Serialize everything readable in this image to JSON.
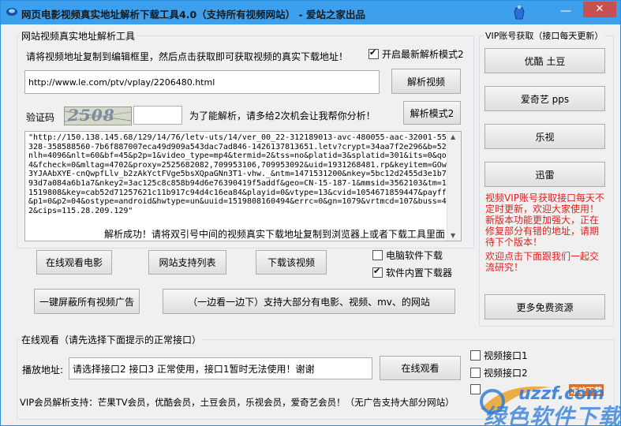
{
  "window": {
    "title": "网页电影视频真实地址解析下载工具4.0（支持所有视频网站） - 爱站之家出品",
    "minimize_glyph": "—",
    "close_glyph": "✕"
  },
  "parser": {
    "group_label": "网站视频真实地址解析工具",
    "instruction": "请将视频地址复制到编辑框里，然后点击获取即可获取视频的真实下载地址！",
    "latest_mode_label": "开启最新解析模式2",
    "latest_mode_checked": true,
    "url_value": "http://www.le.com/ptv/vplay/2206480.html",
    "parse_button": "解析视频",
    "captcha_label": "验证码",
    "captcha_text": "2508",
    "captcha_input_value": "",
    "captcha_hint": "为了能解析，请多给2次机会让我帮你分析！",
    "parse_mode2_button": "解析模式2",
    "result_text": "\"http://150.138.145.68/129/14/76/letv-uts/14/ver_00_22-312189013-avc-480055-aac-32001-5500328-358588560-7b6f887007eca49d909a543dac7ad846-1426137813651.letv?crypt=34aa7f2e296&b=521&nlh=4096&nlt=60&bf=45&p2p=1&video_type=mp4&termid=2&tss=no&platid=3&splatid=301&its=0&qos=4&fcheck=0&mltag=4702&proxy=2525682082,709953106,709953092&uid=1931268481.rp&keyitem=GOw_33YJAAbXYE-cnQwpfLlv_b2zAkYctFVge5bsXQpaGNn3T1-vhw._&ntm=1471531200&nkey=5bc12d2455d3e1b70993d7a084a6b1a7&nkey2=3ac125c8c858b94d6e76390419f5addf&geo=CN-15-187-1&mmsid=3562103&tm=1471519808&key=cab52d71257621c11b917c94d4c16ea84&playid=0&vtype=13&cvid=1054671859447&payff=0&p1=0&p2=04&ostype=android&hwtype=un&uuid=1519808160494&errc=0&gn=1079&vrtmcd=107&buss=4702&cips=115.28.209.129\"",
    "success_text": "解析成功！请将双引号中间的视频真实下载地址复制到浏览器上或者下载工具里面"
  },
  "actions": {
    "watch_online": "在线观看电影",
    "site_list": "网站支持列表",
    "download_video": "下载该视频",
    "pc_download_label": "电脑软件下载",
    "pc_download_checked": false,
    "builtin_download_label": "软件内置下载器",
    "builtin_download_checked": true,
    "block_ads": "一键屏蔽所有视频广告",
    "watch_while_download": "（一边看一边下）支持大部分有电影、视频、mv、的网站"
  },
  "vip": {
    "group_label": "VIP账号获取（接口每天更新）",
    "buttons": [
      "优酷 土豆",
      "爱奇艺 pps",
      "乐视",
      "迅雷"
    ],
    "notice1": "视频VIP账号获取接口每天不定时更新，欢迎大家使用！新版本功能更加强大，正在修复部分有错的地址，请期待下个版本！",
    "notice2": "欢迎点击下面跟我们一起交流研究！",
    "more_resources": "更多免费资源"
  },
  "online": {
    "group_label": "在线观看（请先选择下面提示的正常接口）",
    "play_label": "播放地址:",
    "play_value": "请选择接口2 接口3 正常使用，接口1暂时无法使用！谢谢",
    "watch_button": "在线观看",
    "iface1_label": "视频接口1",
    "iface2_label": "视频接口2",
    "iface1_checked": false,
    "iface2_checked": false,
    "iface3_checked": false,
    "vip_support": "VIP会员解析支持：芒果TV会员，优酷会员，土豆会员，乐视会员，爱奇艺会员！（无广告支持大部分网站）"
  },
  "watermark": {
    "badge": "东坡下载",
    "url": "uzzf.com",
    "slogan": "绿色软件下载"
  },
  "colors": {
    "titlebar": "#3da0ee",
    "close": "#c74f4f",
    "notice": "#e02020"
  }
}
